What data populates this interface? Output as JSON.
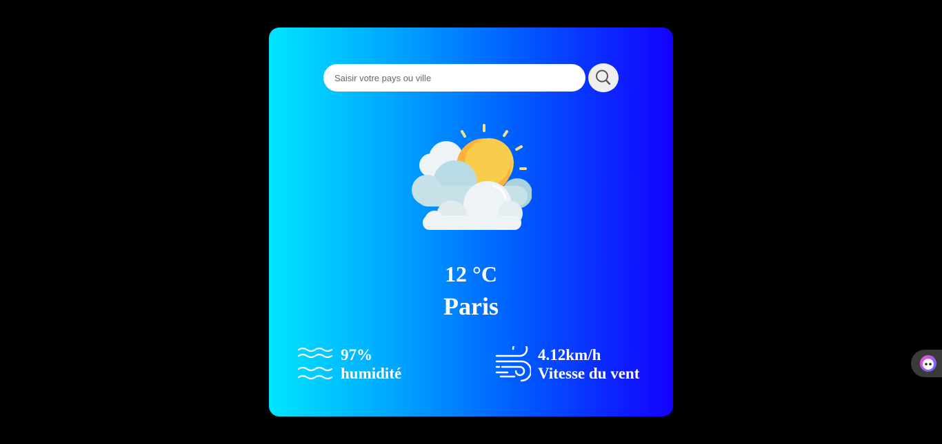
{
  "search": {
    "placeholder": "Saisir votre pays ou ville",
    "value": "",
    "icon": "search-icon"
  },
  "weather": {
    "icon": "partly-cloudy-icon",
    "temperature": "12 °C",
    "city": "Paris"
  },
  "humidity": {
    "icon": "waves-icon",
    "value": "97%",
    "label": "humidité"
  },
  "wind": {
    "icon": "wind-icon",
    "value": "4.12km/h",
    "label": "Vitesse du vent"
  },
  "side_widget": {
    "icon": "assistant-icon"
  },
  "colors": {
    "background": "#000000",
    "gradient_start": "#00e5ff",
    "gradient_end": "#1400ff",
    "text": "#ffffff"
  }
}
